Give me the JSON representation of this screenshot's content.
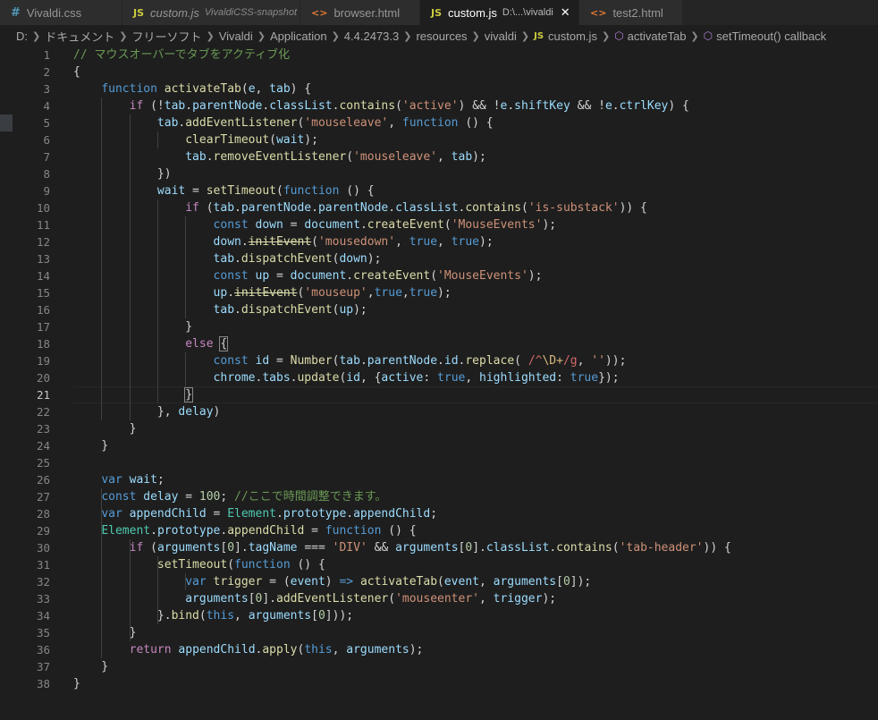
{
  "tabs": [
    {
      "icon": "#",
      "label": "Vivaldi.css",
      "desc": "",
      "italic": false,
      "active": false
    },
    {
      "icon": "JS",
      "label": "custom.js",
      "desc": "VivaldiCSS-snapshot",
      "italic": true,
      "active": false
    },
    {
      "icon": "<>",
      "label": "browser.html",
      "desc": "",
      "italic": false,
      "active": false
    },
    {
      "icon": "JS",
      "label": "custom.js",
      "desc": "D:\\...\\vivaldi",
      "italic": false,
      "active": true,
      "close": "✕"
    },
    {
      "icon": "<>",
      "label": "test2.html",
      "desc": "",
      "italic": false,
      "active": false
    }
  ],
  "breadcrumb": [
    "D:",
    "ドキュメント",
    "フリーソフト",
    "Vivaldi",
    "Application",
    "4.4.2473.3",
    "resources",
    "vivaldi",
    "custom.js",
    "activateTab",
    "setTimeout() callback"
  ],
  "breadcrumb_icons": {
    "file": "JS",
    "symbol": "cube-icon"
  },
  "cursor_line": 21,
  "lines": [
    [
      [
        "c",
        "// マウスオーバーでタブをアクティブ化"
      ]
    ],
    [
      [
        "p",
        "{"
      ]
    ],
    [
      [
        "p",
        "    "
      ],
      [
        "k",
        "function"
      ],
      [
        "p",
        " "
      ],
      [
        "f",
        "activateTab"
      ],
      [
        "p",
        "("
      ],
      [
        "v",
        "e"
      ],
      [
        "p",
        ", "
      ],
      [
        "v",
        "tab"
      ],
      [
        "p",
        ") {"
      ]
    ],
    [
      [
        "p",
        "        "
      ],
      [
        "ctl",
        "if"
      ],
      [
        "p",
        " (!"
      ],
      [
        "v",
        "tab"
      ],
      [
        "p",
        "."
      ],
      [
        "v",
        "parentNode"
      ],
      [
        "p",
        "."
      ],
      [
        "v",
        "classList"
      ],
      [
        "p",
        "."
      ],
      [
        "f",
        "contains"
      ],
      [
        "p",
        "("
      ],
      [
        "s",
        "'active'"
      ],
      [
        "p",
        ") && !"
      ],
      [
        "v",
        "e"
      ],
      [
        "p",
        "."
      ],
      [
        "v",
        "shiftKey"
      ],
      [
        "p",
        " && !"
      ],
      [
        "v",
        "e"
      ],
      [
        "p",
        "."
      ],
      [
        "v",
        "ctrlKey"
      ],
      [
        "p",
        ") {"
      ]
    ],
    [
      [
        "p",
        "            "
      ],
      [
        "v",
        "tab"
      ],
      [
        "p",
        "."
      ],
      [
        "f",
        "addEventListener"
      ],
      [
        "p",
        "("
      ],
      [
        "s",
        "'mouseleave'"
      ],
      [
        "p",
        ", "
      ],
      [
        "k",
        "function"
      ],
      [
        "p",
        " () {"
      ]
    ],
    [
      [
        "p",
        "                "
      ],
      [
        "f",
        "clearTimeout"
      ],
      [
        "p",
        "("
      ],
      [
        "v",
        "wait"
      ],
      [
        "p",
        ");"
      ]
    ],
    [
      [
        "p",
        "                "
      ],
      [
        "v",
        "tab"
      ],
      [
        "p",
        "."
      ],
      [
        "f",
        "removeEventListener"
      ],
      [
        "p",
        "("
      ],
      [
        "s",
        "'mouseleave'"
      ],
      [
        "p",
        ", "
      ],
      [
        "v",
        "tab"
      ],
      [
        "p",
        ");"
      ]
    ],
    [
      [
        "p",
        "            })"
      ]
    ],
    [
      [
        "p",
        "            "
      ],
      [
        "v",
        "wait"
      ],
      [
        "p",
        " = "
      ],
      [
        "f",
        "setTimeout"
      ],
      [
        "p",
        "("
      ],
      [
        "k",
        "function"
      ],
      [
        "p",
        " () {"
      ]
    ],
    [
      [
        "p",
        "                "
      ],
      [
        "ctl",
        "if"
      ],
      [
        "p",
        " ("
      ],
      [
        "v",
        "tab"
      ],
      [
        "p",
        "."
      ],
      [
        "v",
        "parentNode"
      ],
      [
        "p",
        "."
      ],
      [
        "v",
        "parentNode"
      ],
      [
        "p",
        "."
      ],
      [
        "v",
        "classList"
      ],
      [
        "p",
        "."
      ],
      [
        "f",
        "contains"
      ],
      [
        "p",
        "("
      ],
      [
        "s",
        "'is-substack'"
      ],
      [
        "p",
        ")) {"
      ]
    ],
    [
      [
        "p",
        "                    "
      ],
      [
        "k",
        "const"
      ],
      [
        "p",
        " "
      ],
      [
        "v",
        "down"
      ],
      [
        "p",
        " = "
      ],
      [
        "v",
        "document"
      ],
      [
        "p",
        "."
      ],
      [
        "f",
        "createEvent"
      ],
      [
        "p",
        "("
      ],
      [
        "s",
        "'MouseEvents'"
      ],
      [
        "p",
        ");"
      ]
    ],
    [
      [
        "p",
        "                    "
      ],
      [
        "v",
        "down"
      ],
      [
        "p",
        "."
      ],
      [
        "f dep",
        "initEvent"
      ],
      [
        "p",
        "("
      ],
      [
        "s",
        "'mousedown'"
      ],
      [
        "p",
        ", "
      ],
      [
        "k",
        "true"
      ],
      [
        "p",
        ", "
      ],
      [
        "k",
        "true"
      ],
      [
        "p",
        ");"
      ]
    ],
    [
      [
        "p",
        "                    "
      ],
      [
        "v",
        "tab"
      ],
      [
        "p",
        "."
      ],
      [
        "f",
        "dispatchEvent"
      ],
      [
        "p",
        "("
      ],
      [
        "v",
        "down"
      ],
      [
        "p",
        ");"
      ]
    ],
    [
      [
        "p",
        "                    "
      ],
      [
        "k",
        "const"
      ],
      [
        "p",
        " "
      ],
      [
        "v",
        "up"
      ],
      [
        "p",
        " = "
      ],
      [
        "v",
        "document"
      ],
      [
        "p",
        "."
      ],
      [
        "f",
        "createEvent"
      ],
      [
        "p",
        "("
      ],
      [
        "s",
        "'MouseEvents'"
      ],
      [
        "p",
        ");"
      ]
    ],
    [
      [
        "p",
        "                    "
      ],
      [
        "v",
        "up"
      ],
      [
        "p",
        "."
      ],
      [
        "f dep",
        "initEvent"
      ],
      [
        "p",
        "("
      ],
      [
        "s",
        "'mouseup'"
      ],
      [
        "p",
        ","
      ],
      [
        "k",
        "true"
      ],
      [
        "p",
        ","
      ],
      [
        "k",
        "true"
      ],
      [
        "p",
        ");"
      ]
    ],
    [
      [
        "p",
        "                    "
      ],
      [
        "v",
        "tab"
      ],
      [
        "p",
        "."
      ],
      [
        "f",
        "dispatchEvent"
      ],
      [
        "p",
        "("
      ],
      [
        "v",
        "up"
      ],
      [
        "p",
        ");"
      ]
    ],
    [
      [
        "p",
        "                }"
      ]
    ],
    [
      [
        "p",
        "                "
      ],
      [
        "ctl",
        "else"
      ],
      [
        "p",
        " "
      ],
      [
        "p bm",
        "{"
      ]
    ],
    [
      [
        "p",
        "                    "
      ],
      [
        "k",
        "const"
      ],
      [
        "p",
        " "
      ],
      [
        "v",
        "id"
      ],
      [
        "p",
        " = "
      ],
      [
        "f",
        "Number"
      ],
      [
        "p",
        "("
      ],
      [
        "v",
        "tab"
      ],
      [
        "p",
        "."
      ],
      [
        "v",
        "parentNode"
      ],
      [
        "p",
        "."
      ],
      [
        "v",
        "id"
      ],
      [
        "p",
        "."
      ],
      [
        "f",
        "replace"
      ],
      [
        "p",
        "( "
      ],
      [
        "r",
        "/^"
      ],
      [
        "re",
        "\\D+"
      ],
      [
        "r",
        "/g"
      ],
      [
        "p",
        ", "
      ],
      [
        "s",
        "''"
      ],
      [
        "p",
        "));"
      ]
    ],
    [
      [
        "p",
        "                    "
      ],
      [
        "v",
        "chrome"
      ],
      [
        "p",
        "."
      ],
      [
        "v",
        "tabs"
      ],
      [
        "p",
        "."
      ],
      [
        "f",
        "update"
      ],
      [
        "p",
        "("
      ],
      [
        "v",
        "id"
      ],
      [
        "p",
        ", {"
      ],
      [
        "v",
        "active"
      ],
      [
        "p",
        ": "
      ],
      [
        "k",
        "true"
      ],
      [
        "p",
        ", "
      ],
      [
        "v",
        "highlighted"
      ],
      [
        "p",
        ": "
      ],
      [
        "k",
        "true"
      ],
      [
        "p",
        "});"
      ]
    ],
    [
      [
        "p",
        "                "
      ],
      [
        "p bm",
        "}"
      ]
    ],
    [
      [
        "p",
        "            }, "
      ],
      [
        "v",
        "delay"
      ],
      [
        "p",
        ")"
      ]
    ],
    [
      [
        "p",
        "        }"
      ]
    ],
    [
      [
        "p",
        "    }"
      ]
    ],
    [],
    [
      [
        "p",
        "    "
      ],
      [
        "k",
        "var"
      ],
      [
        "p",
        " "
      ],
      [
        "v",
        "wait"
      ],
      [
        "p",
        ";"
      ]
    ],
    [
      [
        "p",
        "    "
      ],
      [
        "k",
        "const"
      ],
      [
        "p",
        " "
      ],
      [
        "v",
        "delay"
      ],
      [
        "p",
        " = "
      ],
      [
        "n",
        "100"
      ],
      [
        "p",
        "; "
      ],
      [
        "c",
        "//ここで時間調整できます。"
      ]
    ],
    [
      [
        "p",
        "    "
      ],
      [
        "k",
        "var"
      ],
      [
        "p",
        " "
      ],
      [
        "v",
        "appendChild"
      ],
      [
        "p",
        " = "
      ],
      [
        "t",
        "Element"
      ],
      [
        "p",
        "."
      ],
      [
        "v",
        "prototype"
      ],
      [
        "p",
        "."
      ],
      [
        "v",
        "appendChild"
      ],
      [
        "p",
        ";"
      ]
    ],
    [
      [
        "p",
        "    "
      ],
      [
        "t",
        "Element"
      ],
      [
        "p",
        "."
      ],
      [
        "v",
        "prototype"
      ],
      [
        "p",
        "."
      ],
      [
        "f",
        "appendChild"
      ],
      [
        "p",
        " = "
      ],
      [
        "k",
        "function"
      ],
      [
        "p",
        " () {"
      ]
    ],
    [
      [
        "p",
        "        "
      ],
      [
        "ctl",
        "if"
      ],
      [
        "p",
        " ("
      ],
      [
        "v",
        "arguments"
      ],
      [
        "p",
        "["
      ],
      [
        "n",
        "0"
      ],
      [
        "p",
        "]."
      ],
      [
        "v",
        "tagName"
      ],
      [
        "p",
        " === "
      ],
      [
        "s",
        "'DIV'"
      ],
      [
        "p",
        " && "
      ],
      [
        "v",
        "arguments"
      ],
      [
        "p",
        "["
      ],
      [
        "n",
        "0"
      ],
      [
        "p",
        "]."
      ],
      [
        "v",
        "classList"
      ],
      [
        "p",
        "."
      ],
      [
        "f",
        "contains"
      ],
      [
        "p",
        "("
      ],
      [
        "s",
        "'tab-header'"
      ],
      [
        "p",
        ")) {"
      ]
    ],
    [
      [
        "p",
        "            "
      ],
      [
        "f",
        "setTimeout"
      ],
      [
        "p",
        "("
      ],
      [
        "k",
        "function"
      ],
      [
        "p",
        " () {"
      ]
    ],
    [
      [
        "p",
        "                "
      ],
      [
        "k",
        "var"
      ],
      [
        "p",
        " "
      ],
      [
        "f",
        "trigger"
      ],
      [
        "p",
        " = ("
      ],
      [
        "v",
        "event"
      ],
      [
        "p",
        ") "
      ],
      [
        "k",
        "=>"
      ],
      [
        "p",
        " "
      ],
      [
        "f",
        "activateTab"
      ],
      [
        "p",
        "("
      ],
      [
        "v",
        "event"
      ],
      [
        "p",
        ", "
      ],
      [
        "v",
        "arguments"
      ],
      [
        "p",
        "["
      ],
      [
        "n",
        "0"
      ],
      [
        "p",
        "]);"
      ]
    ],
    [
      [
        "p",
        "                "
      ],
      [
        "v",
        "arguments"
      ],
      [
        "p",
        "["
      ],
      [
        "n",
        "0"
      ],
      [
        "p",
        "]."
      ],
      [
        "f",
        "addEventListener"
      ],
      [
        "p",
        "("
      ],
      [
        "s",
        "'mouseenter'"
      ],
      [
        "p",
        ", "
      ],
      [
        "v",
        "trigger"
      ],
      [
        "p",
        ");"
      ]
    ],
    [
      [
        "p",
        "            }."
      ],
      [
        "f",
        "bind"
      ],
      [
        "p",
        "("
      ],
      [
        "k",
        "this"
      ],
      [
        "p",
        ", "
      ],
      [
        "v",
        "arguments"
      ],
      [
        "p",
        "["
      ],
      [
        "n",
        "0"
      ],
      [
        "p",
        "]));"
      ]
    ],
    [
      [
        "p",
        "        }"
      ]
    ],
    [
      [
        "p",
        "        "
      ],
      [
        "ctl",
        "return"
      ],
      [
        "p",
        " "
      ],
      [
        "v",
        "appendChild"
      ],
      [
        "p",
        "."
      ],
      [
        "f",
        "apply"
      ],
      [
        "p",
        "("
      ],
      [
        "k",
        "this"
      ],
      [
        "p",
        ", "
      ],
      [
        "v",
        "arguments"
      ],
      [
        "p",
        ");"
      ]
    ],
    [
      [
        "p",
        "    }"
      ]
    ],
    [
      [
        "p",
        "}"
      ]
    ]
  ]
}
